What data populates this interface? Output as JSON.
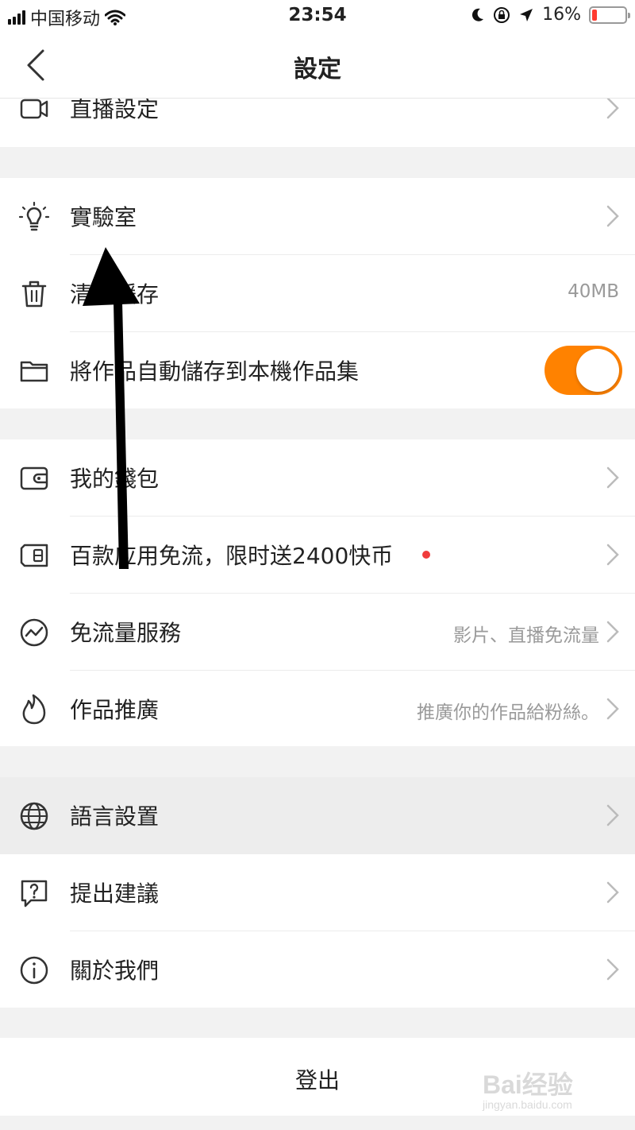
{
  "status_bar": {
    "carrier": "中国移动",
    "time": "23:54",
    "battery_percent": "16%",
    "battery_level": 0.16,
    "icons": [
      "signal-icon",
      "wifi-icon",
      "moon-icon",
      "rotation-lock-icon",
      "location-icon",
      "battery-icon"
    ]
  },
  "nav": {
    "title": "設定",
    "back_icon": "back-chevron-icon"
  },
  "groups": {
    "top": {
      "live_settings": "直播設定"
    },
    "general": {
      "lab": "實驗室",
      "clear_cache": "清除緩存",
      "cache_size": "40MB",
      "autosave": "將作品自動儲存到本機作品集",
      "autosave_on": true
    },
    "services": {
      "wallet": "我的錢包",
      "free_data_promo": "百款应用免流，限时送2400快币",
      "free_data_service": "免流量服務",
      "free_data_service_value": "影片、直播免流量",
      "promote": "作品推廣",
      "promote_value": "推廣你的作品給粉絲。"
    },
    "misc": {
      "language": "語言設置",
      "feedback": "提出建議",
      "about": "關於我們"
    }
  },
  "logout": "登出",
  "watermark": {
    "logo": "Bai经验",
    "url": "jingyan.baidu.com"
  },
  "colors": {
    "accent": "#ff8200",
    "badge": "#f03c3c",
    "background": "#f2f2f2",
    "annotation_arrow": "#000000"
  }
}
